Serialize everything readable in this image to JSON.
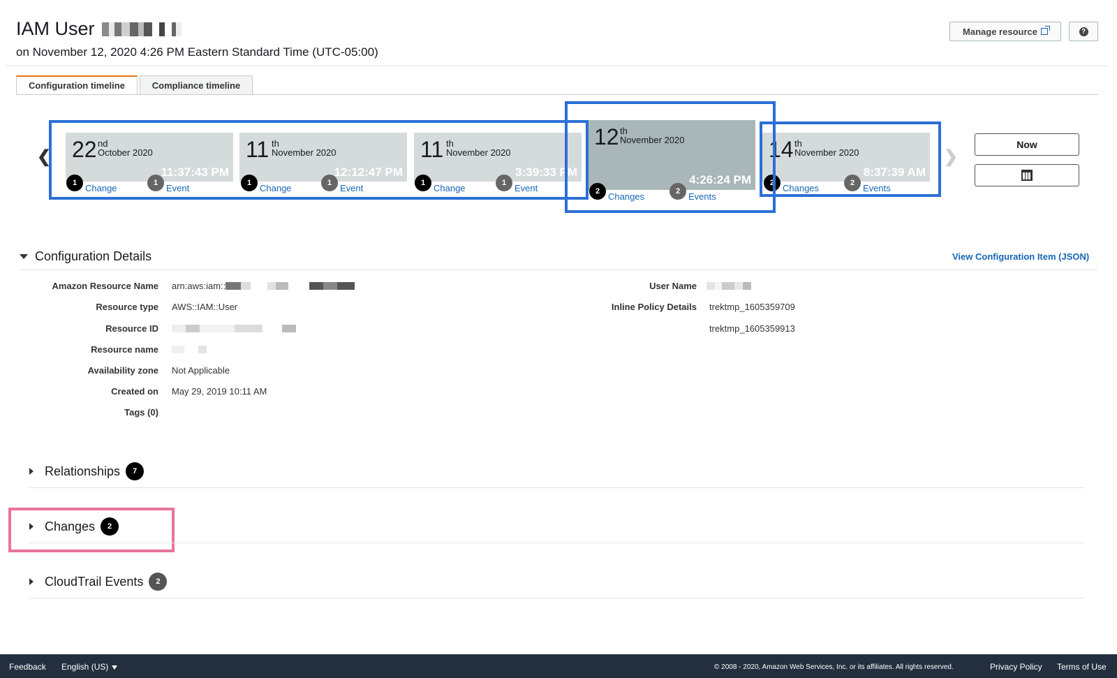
{
  "header": {
    "title": "IAM User",
    "subtitle": "on November 12, 2020 4:26 PM Eastern Standard Time (UTC-05:00)",
    "manage_label": "Manage resource",
    "help_label": "?"
  },
  "tabs": [
    {
      "label": "Configuration timeline",
      "active": true
    },
    {
      "label": "Compliance timeline",
      "active": false
    }
  ],
  "timeline": {
    "cards": [
      {
        "day": "22",
        "suffix": "nd",
        "month": "October 2020",
        "time": "11:37:43 PM",
        "changes_count": "1",
        "changes_label": "Change",
        "events_count": "1",
        "events_label": "Event"
      },
      {
        "day": "11",
        "suffix": "th",
        "month": "November 2020",
        "time": "12:12:47 PM",
        "changes_count": "1",
        "changes_label": "Change",
        "events_count": "1",
        "events_label": "Event"
      },
      {
        "day": "11",
        "suffix": "th",
        "month": "November 2020",
        "time": "3:39:33 PM",
        "changes_count": "1",
        "changes_label": "Change",
        "events_count": "1",
        "events_label": "Event"
      },
      {
        "day": "12",
        "suffix": "th",
        "month": "November 2020",
        "time": "4:26:24 PM",
        "changes_count": "2",
        "changes_label": "Changes",
        "events_count": "2",
        "events_label": "Events",
        "selected": true
      },
      {
        "day": "14",
        "suffix": "th",
        "month": "November 2020",
        "time": "8:37:39 AM",
        "changes_count": "2",
        "changes_label": "Changes",
        "events_count": "2",
        "events_label": "Events"
      }
    ],
    "prev_icon": "chevron-left-icon",
    "next_icon": "chevron-right-icon",
    "now_label": "Now",
    "calendar_icon": "calendar-icon"
  },
  "config": {
    "title": "Configuration Details",
    "view_json_label": "View Configuration Item (JSON)",
    "left": [
      {
        "label": "Amazon Resource Name",
        "value": "arn:aws:iam::"
      },
      {
        "label": "Resource type",
        "value": "AWS::IAM::User"
      },
      {
        "label": "Resource ID",
        "value": ""
      },
      {
        "label": "Resource name",
        "value": ""
      },
      {
        "label": "Availability zone",
        "value": "Not Applicable"
      },
      {
        "label": "Created on",
        "value": "May 29, 2019 10:11 AM"
      },
      {
        "label": "Tags (0)",
        "value": ""
      }
    ],
    "right": [
      {
        "label": "User Name",
        "value": ""
      },
      {
        "label": "Inline Policy Details",
        "value": "trektmp_1605359709"
      },
      {
        "label": "",
        "value": "trektmp_1605359913"
      }
    ]
  },
  "sections": [
    {
      "title": "Relationships",
      "count": "7"
    },
    {
      "title": "Changes",
      "count": "2"
    },
    {
      "title": "CloudTrail Events",
      "count": "2"
    }
  ],
  "footer": {
    "feedback": "Feedback",
    "language": "English (US)",
    "copyright": "© 2008 - 2020, Amazon Web Services, Inc. or its affiliates. All rights reserved.",
    "privacy": "Privacy Policy",
    "terms": "Terms of Use"
  },
  "colors": {
    "accent": "#ec7211",
    "link": "#1766b5",
    "highlight_blue": "#2b6fd6",
    "highlight_pink": "#e8749a",
    "footer_bg": "#232f3e"
  }
}
